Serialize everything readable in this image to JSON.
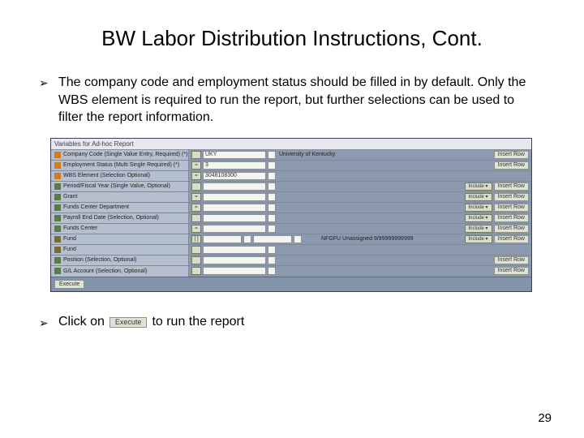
{
  "title": "BW Labor Distribution Instructions, Cont.",
  "bullet1_text": "The company code and employment status should be filled in by default.  Only the WBS element is required to run the report, but further selections can be used to filter the report information.",
  "sshot": {
    "title": "Variables for Ad-hoc Report",
    "rows": [
      {
        "icon": "req",
        "label": "Company Code (Single Value Entry, Required) (*)",
        "op": "",
        "v1": "UKY",
        "v2": "",
        "desc": "University of Kentucky",
        "include": false,
        "inserthtml": true
      },
      {
        "icon": "req",
        "label": "Employment Status (Multi Single Required) (*)",
        "op": "=",
        "v1": "3",
        "v2": "",
        "desc": "",
        "include": false,
        "inserthtml": true
      },
      {
        "icon": "req",
        "label": "WBS Element (Selection Optional)",
        "op": "=",
        "v1": "3048108300",
        "v2": "",
        "desc": "",
        "include": false,
        "inserthtml": false
      },
      {
        "icon": "opt",
        "label": "Period/Fiscal Year (Single Value, Optional)",
        "op": "",
        "v1": "",
        "v2": "",
        "desc": "",
        "include": true,
        "inserthtml": true
      },
      {
        "icon": "opt",
        "label": "Grant",
        "op": "=",
        "v1": "",
        "v2": "",
        "desc": "",
        "include": true,
        "inserthtml": true
      },
      {
        "icon": "opt",
        "label": "Funds Center Department",
        "op": "=",
        "v1": "",
        "v2": "",
        "desc": "",
        "include": true,
        "inserthtml": true
      },
      {
        "icon": "opt",
        "label": "Payroll End Date (Selection, Optional)",
        "op": "",
        "v1": "",
        "v2": "",
        "desc": "",
        "include": true,
        "inserthtml": true
      },
      {
        "icon": "opt",
        "label": "Funds Center",
        "op": "=",
        "v1": "",
        "v2": "",
        "desc": "",
        "include": true,
        "inserthtml": true
      },
      {
        "icon": "gear",
        "label": "Fund",
        "op": "[ ]",
        "v1": "",
        "v2": "",
        "desc": "",
        "desc2": "NFGFU Unassigned  9/99999999999",
        "include": true,
        "inserthtml": true,
        "twoinputs": true
      },
      {
        "icon": "gear",
        "label": "Fund",
        "op": "",
        "v1": "",
        "v2": "",
        "desc": "",
        "include": false,
        "inserthtml": false
      },
      {
        "icon": "opt",
        "label": "Position (Selection, Optional)",
        "op": "",
        "v1": "",
        "v2": "",
        "desc": "",
        "include": false,
        "inserthtml": true
      },
      {
        "icon": "opt",
        "label": "G/L Account (Selection, Optional)",
        "op": "",
        "v1": "",
        "v2": "",
        "desc": "",
        "include": false,
        "inserthtml": true
      }
    ],
    "include_label": "Include",
    "insert_label": "Insert Row",
    "execute_label": "Execute"
  },
  "bullet2_prefix": "Click on",
  "bullet2_btn": "Execute",
  "bullet2_suffix": "to run the report",
  "page_number": "29"
}
